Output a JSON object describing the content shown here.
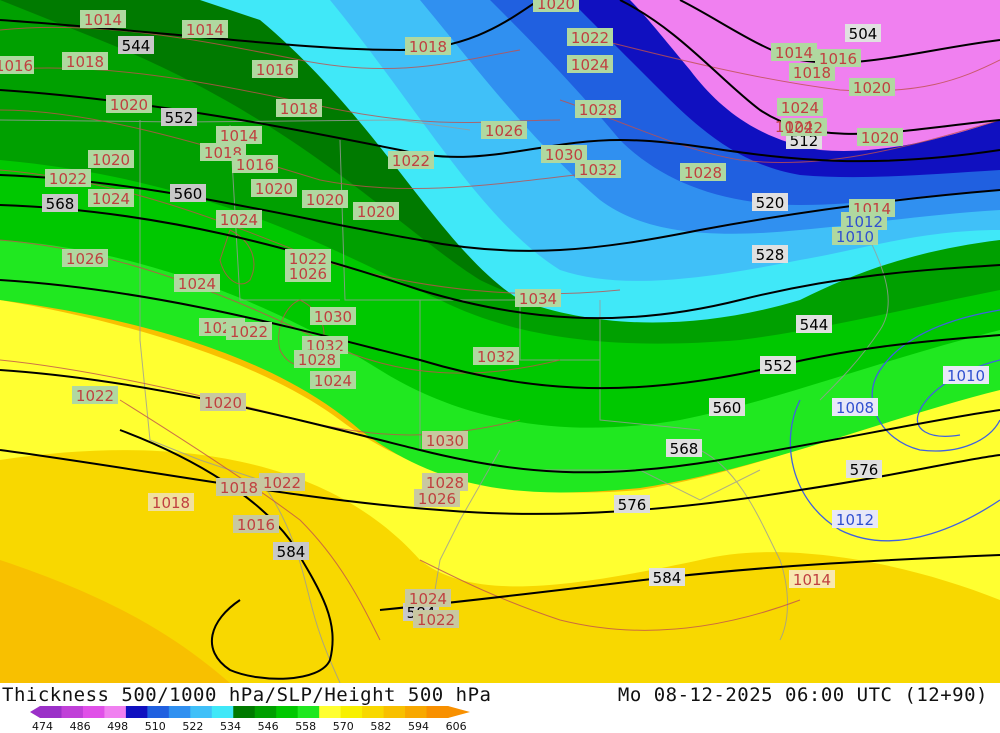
{
  "header": {
    "title": "Thickness 500/1000 hPa/SLP/Height 500 hPa",
    "datetime": "Mo 08-12-2025 06:00 UTC (12+90)"
  },
  "legend": {
    "ticks": [
      "474",
      "486",
      "498",
      "510",
      "522",
      "534",
      "546",
      "558",
      "570",
      "582",
      "594",
      "606"
    ],
    "colors": [
      "#9b30c8",
      "#c040d8",
      "#e050e8",
      "#f080f0",
      "#1010c0",
      "#2060e0",
      "#3090f0",
      "#40c0f8",
      "#40e8f8",
      "#007a00",
      "#00a000",
      "#00c800",
      "#20e820",
      "#ffff30",
      "#f8f000",
      "#f8d800",
      "#f8c000",
      "#f8a800",
      "#f89000"
    ]
  },
  "map": {
    "colors": {
      "violet": "#f080f0",
      "navy": "#1010c0",
      "blue": "#2060e0",
      "mid_blue": "#3090f0",
      "light_blue": "#40c0f8",
      "cyan": "#40e8f8",
      "dark_green": "#007a00",
      "green": "#00a000",
      "bright_green": "#00c800",
      "light_green": "#20e820",
      "yellow": "#ffff30",
      "gold": "#f8d800",
      "orange": "#f8c000"
    },
    "height_labels": [
      "544",
      "552",
      "560",
      "568",
      "576",
      "584",
      "504",
      "512",
      "520",
      "528",
      "544",
      "552",
      "560",
      "568",
      "576",
      "584",
      "584",
      "576"
    ],
    "slp_labels": [
      "1014",
      "1014",
      "1016",
      "1016",
      "1018",
      "1018",
      "1020",
      "1014",
      "1018",
      "1016",
      "1018",
      "1020",
      "1020",
      "1022",
      "1024",
      "1020",
      "1020",
      "1024",
      "1026",
      "1024",
      "1022",
      "1026",
      "1026",
      "1022",
      "1030",
      "1032",
      "1028",
      "1024",
      "1022",
      "1020",
      "1018",
      "1018",
      "1022",
      "1016",
      "1030",
      "1028",
      "1026",
      "1024",
      "1022",
      "1032",
      "1034",
      "1030",
      "1032",
      "1028",
      "1026",
      "1024",
      "1022",
      "1020",
      "1022",
      "1024",
      "1028",
      "1018",
      "1016",
      "1014",
      "1020",
      "1022",
      "1024",
      "1020",
      "1014",
      "1012",
      "1010",
      "1010",
      "1008",
      "1012",
      "1014"
    ]
  }
}
